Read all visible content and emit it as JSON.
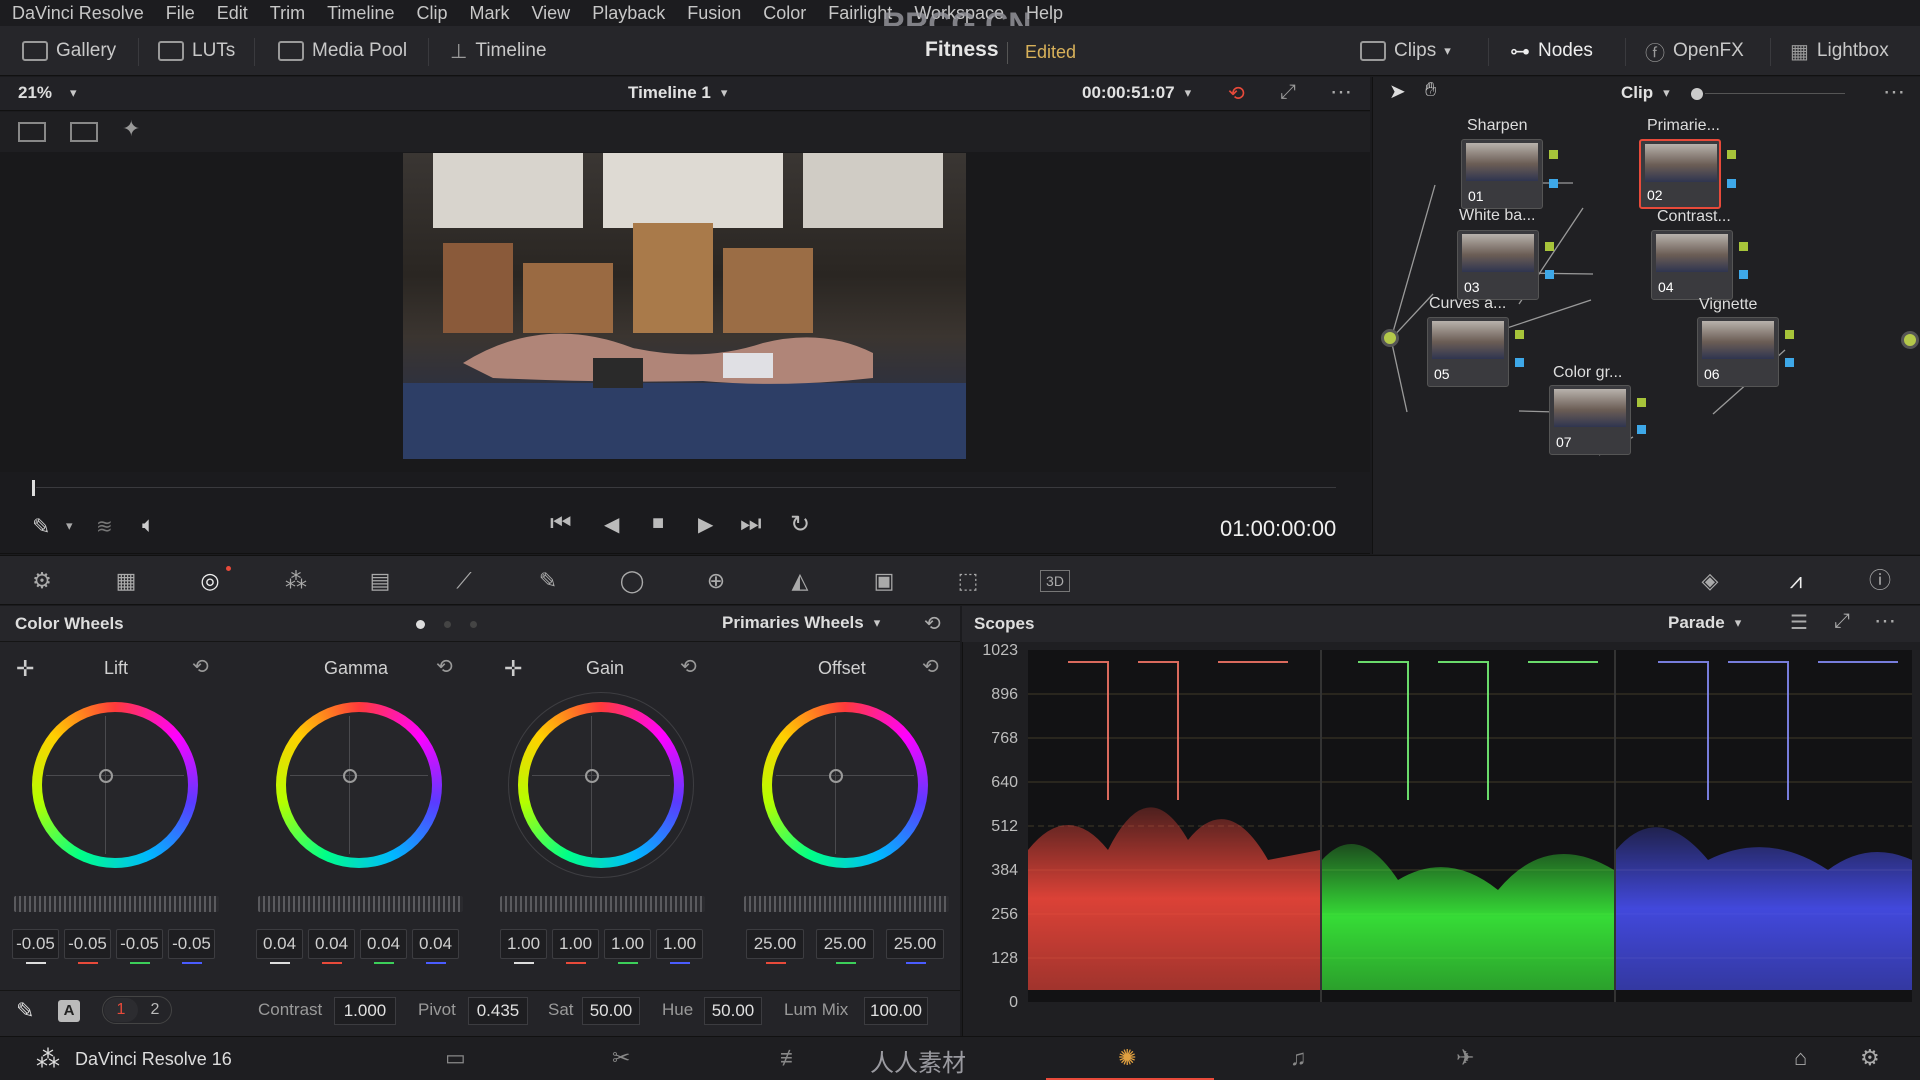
{
  "menu": [
    "DaVinci Resolve",
    "File",
    "Edit",
    "Trim",
    "Timeline",
    "Clip",
    "Mark",
    "View",
    "Playback",
    "Fusion",
    "Color",
    "Fairlight",
    "Workspace",
    "Help"
  ],
  "watermark": "RRCG.CN",
  "topbar": {
    "gallery": "Gallery",
    "luts": "LUTs",
    "media_pool": "Media Pool",
    "timeline": "Timeline",
    "project_name": "Fitness",
    "project_status": "Edited",
    "clips": "Clips",
    "nodes": "Nodes",
    "openfx": "OpenFX",
    "lightbox": "Lightbox"
  },
  "viewer": {
    "zoom": "21%",
    "timeline_name": "Timeline 1",
    "timecode": "00:00:51:07",
    "playhead_timecode": "01:00:00:00",
    "node_mode": "Clip"
  },
  "nodes": [
    {
      "label": "Sharpen",
      "num": "01"
    },
    {
      "label": "Primarie...",
      "num": "02"
    },
    {
      "label": "White ba...",
      "num": "03"
    },
    {
      "label": "Contrast...",
      "num": "04"
    },
    {
      "label": "Curves a...",
      "num": "05"
    },
    {
      "label": "Vignette",
      "num": "06"
    },
    {
      "label": "Color gr...",
      "num": "07"
    }
  ],
  "color_wheels": {
    "title": "Color Wheels",
    "mode": "Primaries Wheels",
    "wheels": [
      {
        "name": "Lift",
        "values": [
          "-0.05",
          "-0.05",
          "-0.05",
          "-0.05"
        ]
      },
      {
        "name": "Gamma",
        "values": [
          "0.04",
          "0.04",
          "0.04",
          "0.04"
        ]
      },
      {
        "name": "Gain",
        "values": [
          "1.00",
          "1.00",
          "1.00",
          "1.00"
        ]
      },
      {
        "name": "Offset",
        "values": [
          "25.00",
          "25.00",
          "25.00"
        ]
      }
    ],
    "footer": {
      "auto": "A",
      "page1": "1",
      "page2": "2",
      "contrast_label": "Contrast",
      "contrast": "1.000",
      "pivot_label": "Pivot",
      "pivot": "0.435",
      "sat_label": "Sat",
      "sat": "50.00",
      "hue_label": "Hue",
      "hue": "50.00",
      "lummix_label": "Lum Mix",
      "lummix": "100.00"
    }
  },
  "scopes": {
    "title": "Scopes",
    "mode": "Parade",
    "y_ticks": [
      "1023",
      "896",
      "768",
      "640",
      "512",
      "384",
      "256",
      "128",
      "0"
    ],
    "colors": {
      "red": "#ff4a3d",
      "green": "#3cff3c",
      "blue": "#4a52ff"
    }
  },
  "bottombar": {
    "app": "DaVinci Resolve 16",
    "watermark": "人人素材"
  },
  "colors": {
    "accent": "#d8b15a",
    "selected_node": "#e84a3a"
  }
}
